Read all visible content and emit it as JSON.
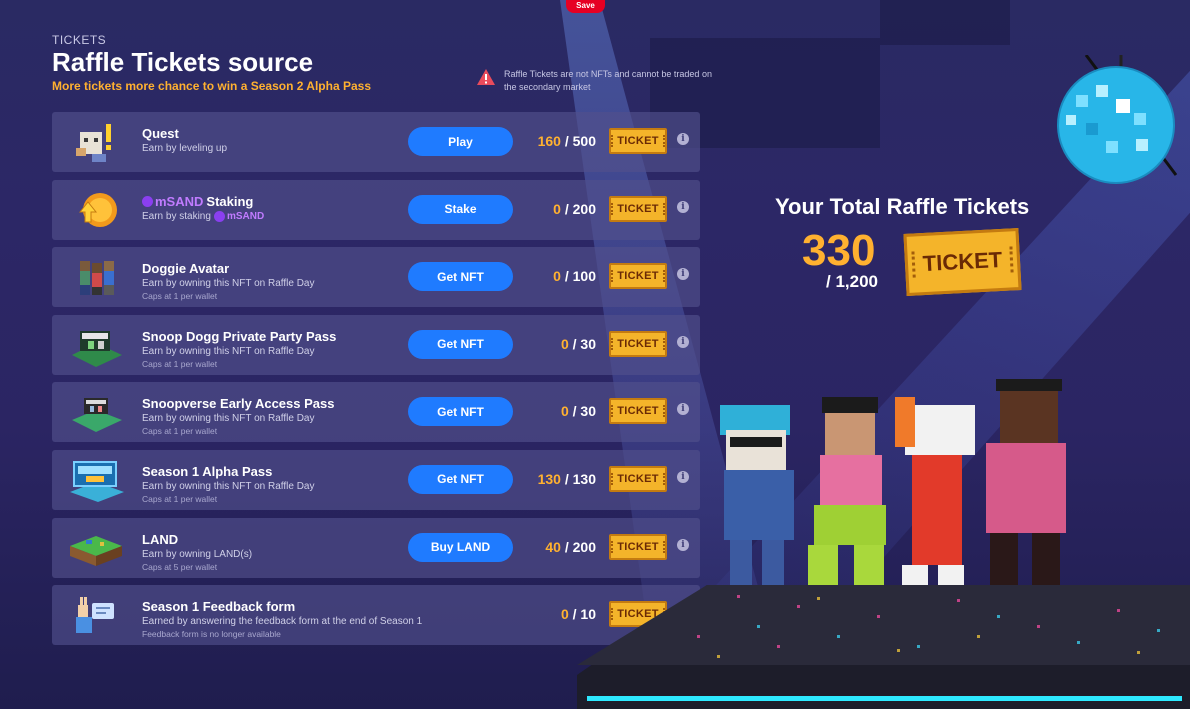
{
  "topbar": {
    "save_label": "Save"
  },
  "header": {
    "eyebrow": "TICKETS",
    "title": "Raffle Tickets source",
    "subtitle": "More tickets more chance to win a Season 2 Alpha Pass"
  },
  "warning": {
    "icon": "warning-triangle-icon",
    "text": "Raffle Tickets are not NFTs and cannot be traded on the secondary market"
  },
  "colors": {
    "accent": "#1f7bff",
    "highlight": "#ffb130",
    "msand": "#c07bff",
    "warning": "#e94b5c"
  },
  "ticket_label": "TICKET",
  "rows": [
    {
      "title": "Quest",
      "desc": "Earn by leveling up",
      "cap": "",
      "button": "Play",
      "current": "160",
      "max": "500",
      "icon": "quest-character-icon"
    },
    {
      "title_prefix": "mSAND",
      "title": "Staking",
      "desc": "Earn by staking",
      "desc_suffix": "mSAND",
      "cap": "",
      "button": "Stake",
      "current": "0",
      "max": "200",
      "icon": "staking-coin-icon"
    },
    {
      "title": "Doggie Avatar",
      "desc": "Earn by owning this NFT on Raffle Day",
      "cap": "Caps at 1 per wallet",
      "button": "Get NFT",
      "current": "0",
      "max": "100",
      "icon": "doggie-avatar-icon"
    },
    {
      "title": "Snoop Dogg Private Party Pass",
      "desc": "Earn by owning this NFT on Raffle Day",
      "cap": "Caps at 1 per wallet",
      "button": "Get NFT",
      "current": "0",
      "max": "30",
      "icon": "party-pass-icon"
    },
    {
      "title": "Snoopverse Early Access Pass",
      "desc": "Earn by owning this NFT on Raffle Day",
      "cap": "Caps at 1 per wallet",
      "button": "Get NFT",
      "current": "0",
      "max": "30",
      "icon": "early-access-pass-icon"
    },
    {
      "title": "Season 1 Alpha Pass",
      "desc": "Earn by owning this NFT on Raffle Day",
      "cap": "Caps at 1 per wallet",
      "button": "Get NFT",
      "current": "130",
      "max": "130",
      "icon": "alpha-pass-icon"
    },
    {
      "title": "LAND",
      "desc": "Earn by owning LAND(s)",
      "cap": "Caps at 5 per wallet",
      "button": "Buy LAND",
      "current": "40",
      "max": "200",
      "icon": "land-icon"
    },
    {
      "title": "Season 1 Feedback form",
      "desc": "Earned by answering the feedback form at the end of Season 1",
      "cap": "Feedback form is no longer available",
      "button": "",
      "current": "0",
      "max": "10",
      "icon": "feedback-icon"
    }
  ],
  "total": {
    "title": "Your Total Raffle Tickets",
    "current": "330",
    "max": "/ 1,200"
  }
}
